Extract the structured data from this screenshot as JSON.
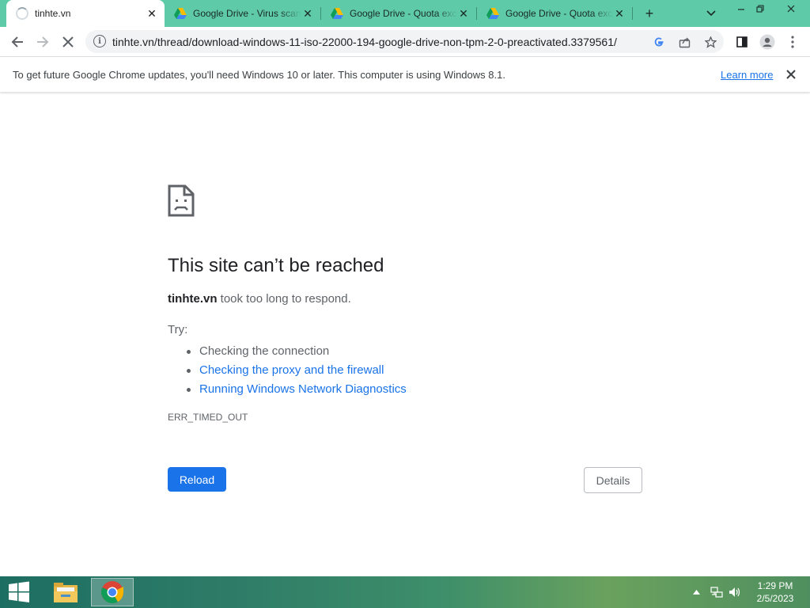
{
  "browser": {
    "tabs": [
      {
        "title": "tinhte.vn",
        "icon": "loading-spinner",
        "active": true
      },
      {
        "title": "Google Drive - Virus scan warning",
        "icon": "google-drive-icon",
        "active": false
      },
      {
        "title": "Google Drive - Quota exceeded",
        "icon": "google-drive-icon",
        "active": false
      },
      {
        "title": "Google Drive - Quota exceeded",
        "icon": "google-drive-icon",
        "active": false
      }
    ],
    "new_tab_glyph": "+",
    "url": "tinhte.vn/thread/download-windows-11-iso-22000-194-google-drive-non-tpm-2-0-preactivated.3379561/",
    "infobar": {
      "message": "To get future Google Chrome updates, you'll need Windows 10 or later. This computer is using Windows 8.1.",
      "link": "Learn more"
    }
  },
  "error_page": {
    "title": "This site can’t be reached",
    "host": "tinhte.vn",
    "summary_rest": " took too long to respond.",
    "try_label": "Try:",
    "suggestions": [
      {
        "text": "Checking the connection",
        "link": false
      },
      {
        "text": "Checking the proxy and the firewall",
        "link": true
      },
      {
        "text": "Running Windows Network Diagnostics",
        "link": true
      }
    ],
    "error_code": "ERR_TIMED_OUT",
    "reload_label": "Reload",
    "details_label": "Details"
  },
  "taskbar": {
    "apps": [
      "file-explorer-icon",
      "chrome-icon"
    ],
    "time": "1:29 PM",
    "date": "2/5/2023"
  },
  "colors": {
    "tabstrip": "#5ecaa8",
    "accent_blue": "#1a73e8",
    "text_secondary": "#5f6368"
  }
}
